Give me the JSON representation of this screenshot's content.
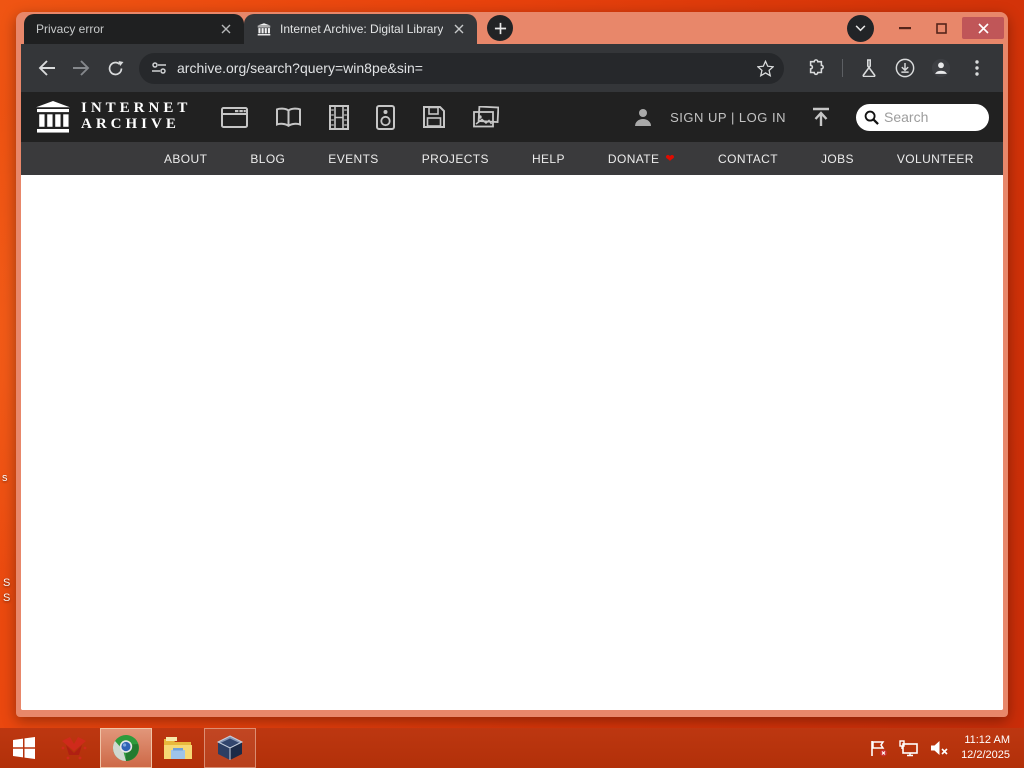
{
  "browser": {
    "tabs": [
      {
        "title": "Privacy error",
        "active": false
      },
      {
        "title": "Internet Archive: Digital Library",
        "active": true
      }
    ],
    "url": "archive.org/search?query=win8pe&sin="
  },
  "site": {
    "logo_line1": "INTERNET",
    "logo_line2": "ARCHIVE",
    "media_types": [
      "web",
      "texts",
      "video",
      "audio",
      "software",
      "images"
    ],
    "auth_text": "SIGN UP | LOG IN",
    "search_placeholder": "Search",
    "nav": [
      "ABOUT",
      "BLOG",
      "EVENTS",
      "PROJECTS",
      "HELP",
      "DONATE",
      "CONTACT",
      "JOBS",
      "VOLUNTEER"
    ],
    "donate_heart": "❤"
  },
  "taskbar": {
    "time": "11:12 AM",
    "date": "12/2/2025"
  },
  "desktop": {
    "fragments": [
      "s",
      "S",
      "S"
    ]
  },
  "colors": {
    "titlebar_accent": "#e8876a",
    "toolbar_dark": "#343639",
    "ia_header": "#212121",
    "ia_nav": "#3a3a3c",
    "taskbar_red": "#b93310",
    "close_button": "#c05658",
    "donate_heart": "#e00b00"
  }
}
